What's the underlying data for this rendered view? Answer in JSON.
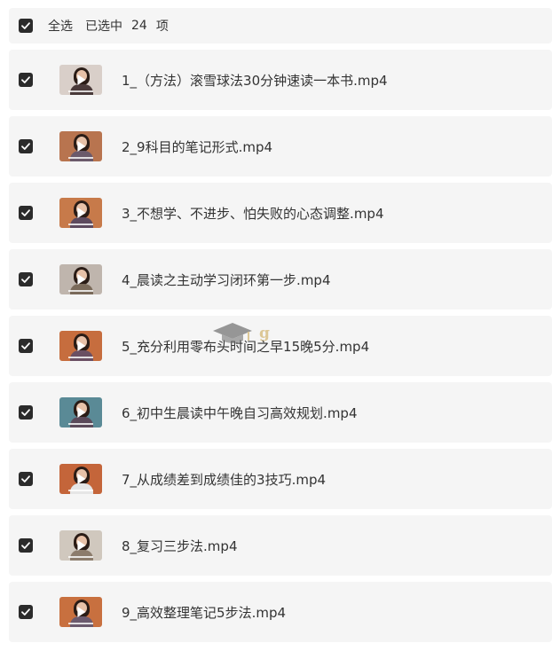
{
  "header": {
    "select_all_label": "全选",
    "selected_prefix": "已选中",
    "selected_count": "24",
    "selected_suffix": "项",
    "checked": true
  },
  "files": [
    {
      "name": "1_（方法）滚雪球法30分钟速读一本书.mp4",
      "checked": true,
      "thumb_wall": "#d9cfc9",
      "thumb_body": "#4a3a3a"
    },
    {
      "name": "2_9科目的笔记形式.mp4",
      "checked": true,
      "thumb_wall": "#b8744f",
      "thumb_body": "#6b5a6b"
    },
    {
      "name": "3_不想学、不进步、怕失败的心态调整.mp4",
      "checked": true,
      "thumb_wall": "#c77a4a",
      "thumb_body": "#5d4a5e"
    },
    {
      "name": "4_晨读之主动学习闭环第一步.mp4",
      "checked": true,
      "thumb_wall": "#bfb5ad",
      "thumb_body": "#7a6a5a"
    },
    {
      "name": "5_充分利用零布头时间之早15晚5分.mp4",
      "checked": true,
      "thumb_wall": "#c66d3e",
      "thumb_body": "#6a4f63"
    },
    {
      "name": "6_初中生晨读中午晚自习高效规划.mp4",
      "checked": true,
      "thumb_wall": "#5a8a96",
      "thumb_body": "#5b4a5a"
    },
    {
      "name": "7_从成绩差到成绩佳的3技巧.mp4",
      "checked": true,
      "thumb_wall": "#c4653a",
      "thumb_body": "#e6e6e6"
    },
    {
      "name": "8_复习三步法.mp4",
      "checked": true,
      "thumb_wall": "#d0c8be",
      "thumb_body": "#8c7c6c"
    },
    {
      "name": "9_高效整理笔记5步法.mp4",
      "checked": true,
      "thumb_wall": "#c8703f",
      "thumb_body": "#6b5a6e"
    }
  ],
  "watermark": {
    "text": "g",
    "icon": "graduation-cap-icon"
  },
  "colors": {
    "row_background": "#f5f5f5",
    "checkbox": "#2b2b2b",
    "text": "#333333"
  }
}
